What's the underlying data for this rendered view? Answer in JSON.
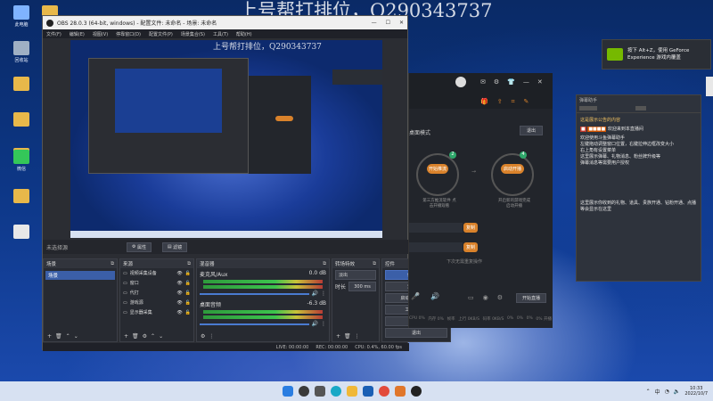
{
  "watermark": {
    "top": "上号帮打排位，Q290343737",
    "preview": "上号帮打排位，Q290343737"
  },
  "desktop": {
    "icons": [
      {
        "label": "此电脑",
        "color": "#7fb3ff"
      },
      {
        "label": "",
        "color": "#e8b84a"
      },
      {
        "label": "回收站",
        "color": "#9fb0c4"
      },
      {
        "label": "",
        "color": "#e8b84a"
      },
      {
        "label": "",
        "color": "#e8b84a"
      },
      {
        "label": "",
        "color": "#e8b84a"
      },
      {
        "label": "",
        "color": "#e8b84a"
      },
      {
        "label": "",
        "color": "#e8b84a"
      },
      {
        "label": "",
        "color": "#e8b84a"
      },
      {
        "label": "",
        "color": "#e8b84a"
      },
      {
        "label": "微信",
        "color": "#34c759"
      },
      {
        "label": "QQ",
        "color": "#222"
      },
      {
        "label": "",
        "color": "#e8b84a"
      },
      {
        "label": "",
        "color": "#e8e8e8"
      }
    ]
  },
  "obs": {
    "title": "OBS 28.0.3 (64-bit, windows) - 配置文件: 未命名 - 场景: 未命名",
    "menu": [
      "文件(F)",
      "编辑(E)",
      "视图(V)",
      "停靠窗口(D)",
      "配置文件(P)",
      "场景集合(S)",
      "工具(T)",
      "帮助(H)"
    ],
    "no_source": "未选择源",
    "props_btn": "属性",
    "filters_btn": "滤镜",
    "scenes": {
      "header": "场景",
      "items": [
        "场景"
      ]
    },
    "sources": {
      "header": "来源",
      "items": [
        "视频采集设备",
        "窗口",
        "代打",
        "游戏源",
        "显示器采集"
      ]
    },
    "mixer": {
      "header": "混音器",
      "channels": [
        {
          "name": "麦克风/Aux",
          "db": "0.0 dB"
        },
        {
          "name": "桌面音频",
          "db": "-6.3 dB"
        }
      ]
    },
    "transitions": {
      "header": "转场特效",
      "type": "淡出",
      "duration_label": "时长",
      "duration": "300 ms"
    },
    "controls": {
      "header": "控件",
      "buttons": [
        "停止推流",
        "开始录制",
        "启动虚拟摄像机",
        "工作室模式",
        "设置",
        "退出"
      ]
    },
    "status": {
      "live": "LIVE: 00:00:00",
      "rec": "REC: 00:00:00",
      "cpu": "CPU: 0.4%, 60.00 fps"
    }
  },
  "app": {
    "mode": "桌面模式",
    "exit": "退出",
    "card1": {
      "btn": "开始推流",
      "step": "2",
      "text": "第三方推流软件 点击开播观看"
    },
    "card2": {
      "btn": "启动开播",
      "step": "4",
      "text": "开启新的游戏完成 启动开播"
    },
    "copy1": "复制",
    "copy2": "复制",
    "hint": "下次无需重复操作",
    "stats": [
      "CPU 0%",
      "内存 0%",
      "帧率",
      "上行 0KB/S",
      "码率 0KB/S",
      "0%",
      "0%",
      "0%",
      "0% 开播"
    ],
    "cta": "开始直播"
  },
  "chat": {
    "title": "弹幕助手",
    "sub": "",
    "msgs": [
      "这是展示公告的内容",
      "欢迎来到本直播间",
      "欢迎使用斗鱼弹幕助手",
      "左键拖动调整窗口位置，右键拉伸边框改变大小",
      "右上角有设置菜单",
      "这里展示弹幕、礼物消息、粉丝牌升级等",
      "弹幕消息等需要用户授权",
      "这里展示你收到的礼物、道具、贵族开通、钻粉开通、点播等会显示在这里"
    ]
  },
  "toast": {
    "line1": "按下 Alt+Z，使用 GeForce",
    "line2": "Experience 游戏内覆盖"
  },
  "clock": {
    "time": "10:33",
    "date": "2022/10/7"
  },
  "colors": {
    "accent": "#d9822b",
    "obsblue": "#3b5fa8",
    "nvidia": "#76b900"
  }
}
